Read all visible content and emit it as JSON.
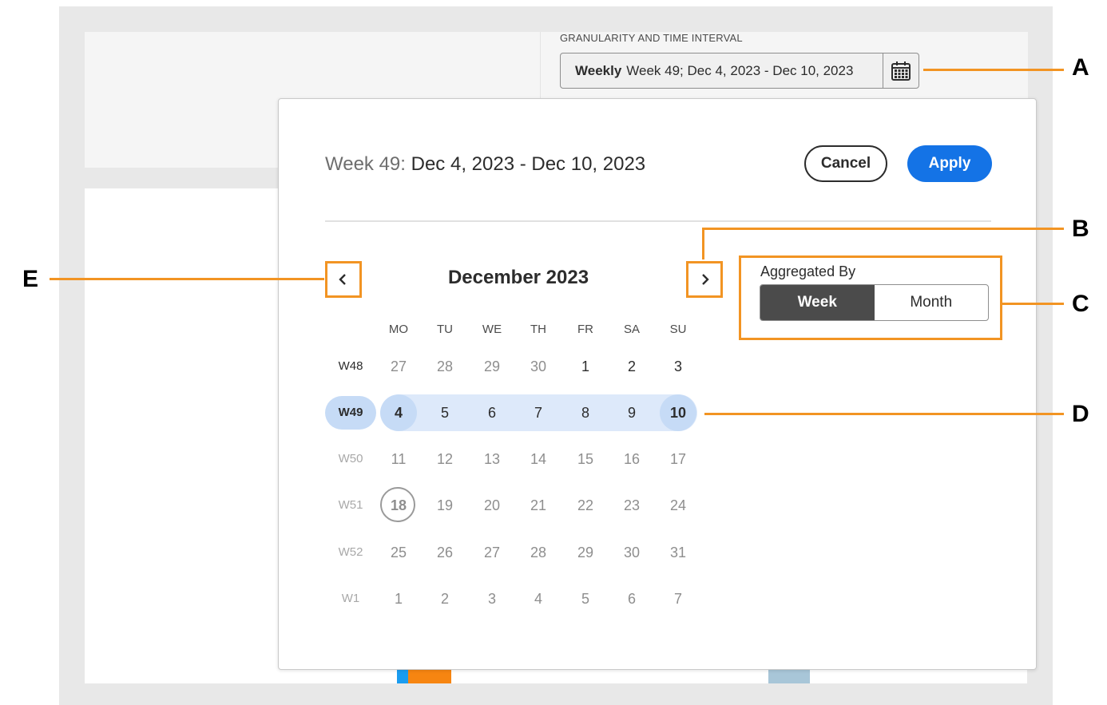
{
  "header": {
    "field_label": "GRANULARITY AND TIME INTERVAL",
    "picker_granularity": "Weekly",
    "picker_value": "Week 49; Dec 4, 2023 - Dec 10, 2023"
  },
  "popover": {
    "title_week": "Week 49:",
    "title_range": "Dec 4, 2023 - Dec 10, 2023",
    "cancel_label": "Cancel",
    "apply_label": "Apply"
  },
  "calendar": {
    "month_title": "December 2023",
    "weekdays": [
      "MO",
      "TU",
      "WE",
      "TH",
      "FR",
      "SA",
      "SU"
    ],
    "weeks": [
      {
        "label": "W48",
        "days": [
          "27",
          "28",
          "29",
          "30",
          "1",
          "2",
          "3"
        ]
      },
      {
        "label": "W49",
        "days": [
          "4",
          "5",
          "6",
          "7",
          "8",
          "9",
          "10"
        ]
      },
      {
        "label": "W50",
        "days": [
          "11",
          "12",
          "13",
          "14",
          "15",
          "16",
          "17"
        ]
      },
      {
        "label": "W51",
        "days": [
          "18",
          "19",
          "20",
          "21",
          "22",
          "23",
          "24"
        ]
      },
      {
        "label": "W52",
        "days": [
          "25",
          "26",
          "27",
          "28",
          "29",
          "30",
          "31"
        ]
      },
      {
        "label": "W1",
        "days": [
          "1",
          "2",
          "3",
          "4",
          "5",
          "6",
          "7"
        ]
      }
    ],
    "selected_week": "W49",
    "today": "18"
  },
  "aggregation": {
    "label": "Aggregated By",
    "options": [
      "Week",
      "Month"
    ],
    "selected": "Week"
  },
  "callouts": {
    "a": "A",
    "b": "B",
    "c": "C",
    "d": "D",
    "e": "E"
  },
  "colors": {
    "accent": "#1473e6",
    "callout": "#f29423",
    "selection": "#dde9fa"
  }
}
